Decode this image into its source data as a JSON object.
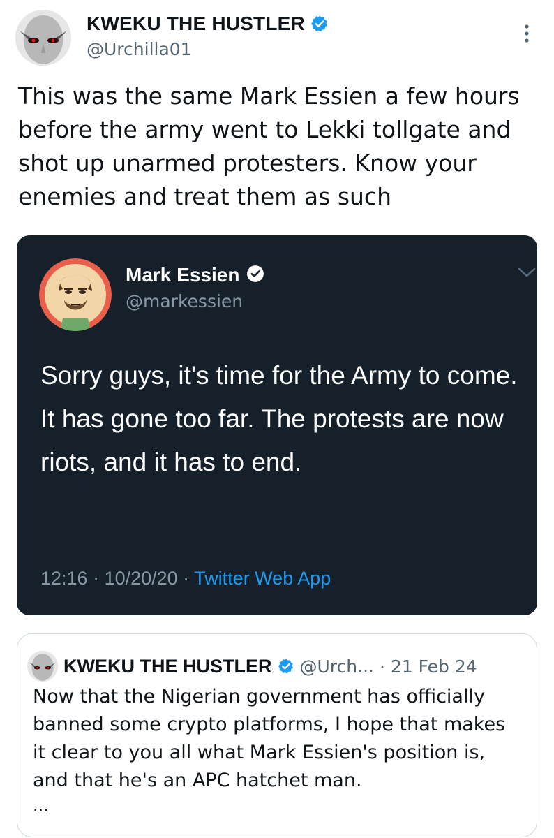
{
  "author": {
    "display_name": "KWEKU THE HUSTLER",
    "handle": "@Urchilla01",
    "verified": true
  },
  "tweet": {
    "text": "This was the same Mark Essien a few hours before the army went to Lekki tollgate and shot up unarmed protesters. Know your enemies and treat them as such"
  },
  "embedded_screenshot": {
    "display_name": "Mark Essien",
    "handle": "@markessien",
    "verified": true,
    "text": "Sorry guys, it's time for the Army to come. It has gone too far. The protests are now riots, and it has to end.",
    "timestamp": "12:16 · 10/20/20 · ",
    "source_app": "Twitter Web App"
  },
  "quoted_tweet": {
    "display_name": "KWEKU THE HUSTLER",
    "handle": "@Urch...",
    "date": "· 21 Feb 24",
    "text": "Now that the Nigerian government has officially banned some crypto platforms, I hope that makes it clear to you all what Mark Essien's position is, and that he's an APC hatchet man.",
    "more": "..."
  },
  "colors": {
    "verified_badge": "#1d9bf0",
    "embed_background": "#15202b",
    "link": "#1d9bf0",
    "secondary_text": "#536471"
  },
  "icons": {
    "verified": "verified-badge-icon",
    "more": "more-vertical-icon",
    "chevron": "chevron-down-icon"
  }
}
